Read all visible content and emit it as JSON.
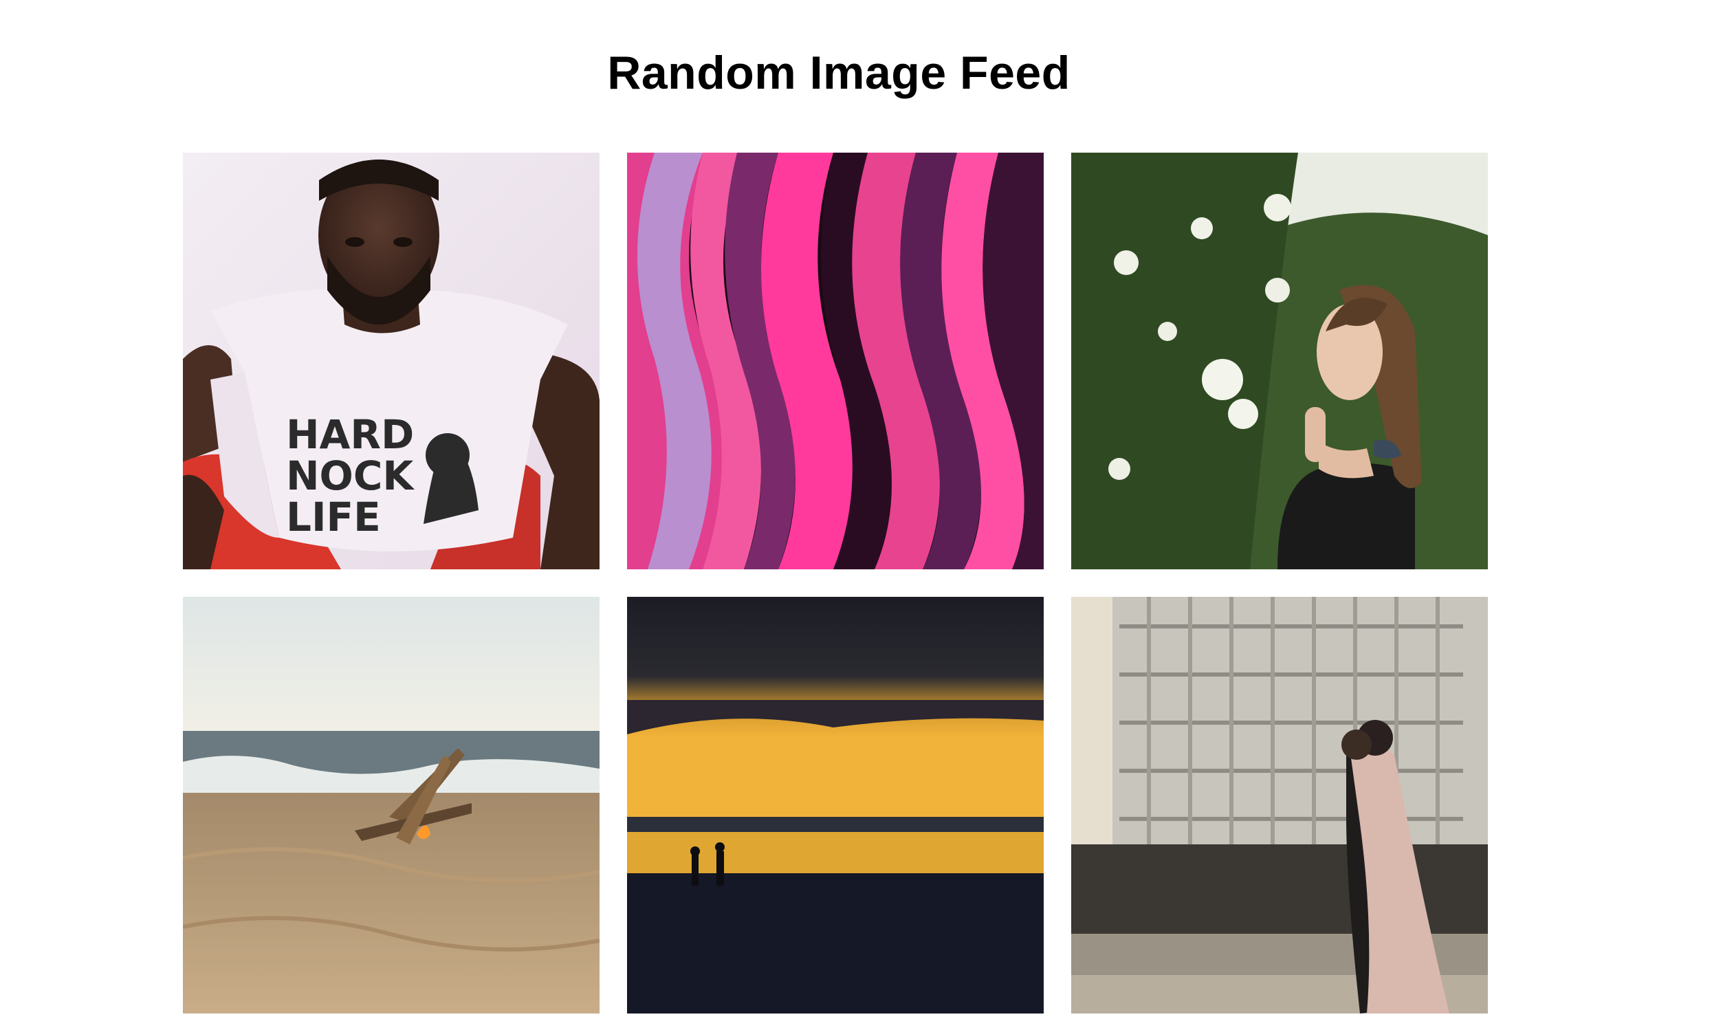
{
  "page": {
    "title": "Random Image Feed"
  },
  "feed": {
    "images": [
      {
        "name": "man-in-hard-knock-life-shirt",
        "shirt_text": "HARD KNOCK LIFE"
      },
      {
        "name": "pink-purple-fluid-paint"
      },
      {
        "name": "woman-smelling-white-flowers"
      },
      {
        "name": "beach-bonfire"
      },
      {
        "name": "sunset-over-sea-with-silhouettes"
      },
      {
        "name": "couple-embracing-on-rooftop"
      }
    ]
  },
  "colors": {
    "background": "#ffffff",
    "title": "#000000"
  }
}
